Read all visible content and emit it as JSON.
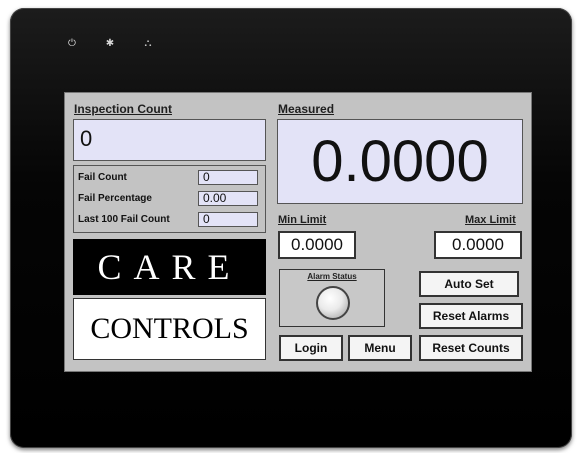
{
  "hardware": {
    "indicators": [
      {
        "name": "power-icon",
        "glyph": "⏻"
      },
      {
        "name": "sun-icon",
        "glyph": "✱"
      },
      {
        "name": "network-icon",
        "glyph": "⛬"
      }
    ]
  },
  "inspection": {
    "label": "Inspection Count",
    "value": "0"
  },
  "fail_panel": {
    "rows": [
      {
        "label": "Fail Count",
        "value": "0"
      },
      {
        "label": "Fail Percentage",
        "value": "0.00"
      },
      {
        "label": "Last 100 Fail Count",
        "value": "0"
      }
    ]
  },
  "logo": {
    "top": "CARE",
    "bottom": "CONTROLS"
  },
  "measured": {
    "label": "Measured",
    "value": "0.0000"
  },
  "limits": {
    "min_label": "Min Limit",
    "min_value": "0.0000",
    "max_label": "Max Limit",
    "max_value": "0.0000"
  },
  "alarm": {
    "label": "Alarm Status"
  },
  "buttons": {
    "auto_set": "Auto Set",
    "reset_alarms": "Reset Alarms",
    "login": "Login",
    "menu": "Menu",
    "reset_counts": "Reset Counts"
  },
  "colors": {
    "field_bg": "#e3e3f7",
    "screen_bg": "#c3c3c3",
    "bezel": "#0a0a0a"
  }
}
